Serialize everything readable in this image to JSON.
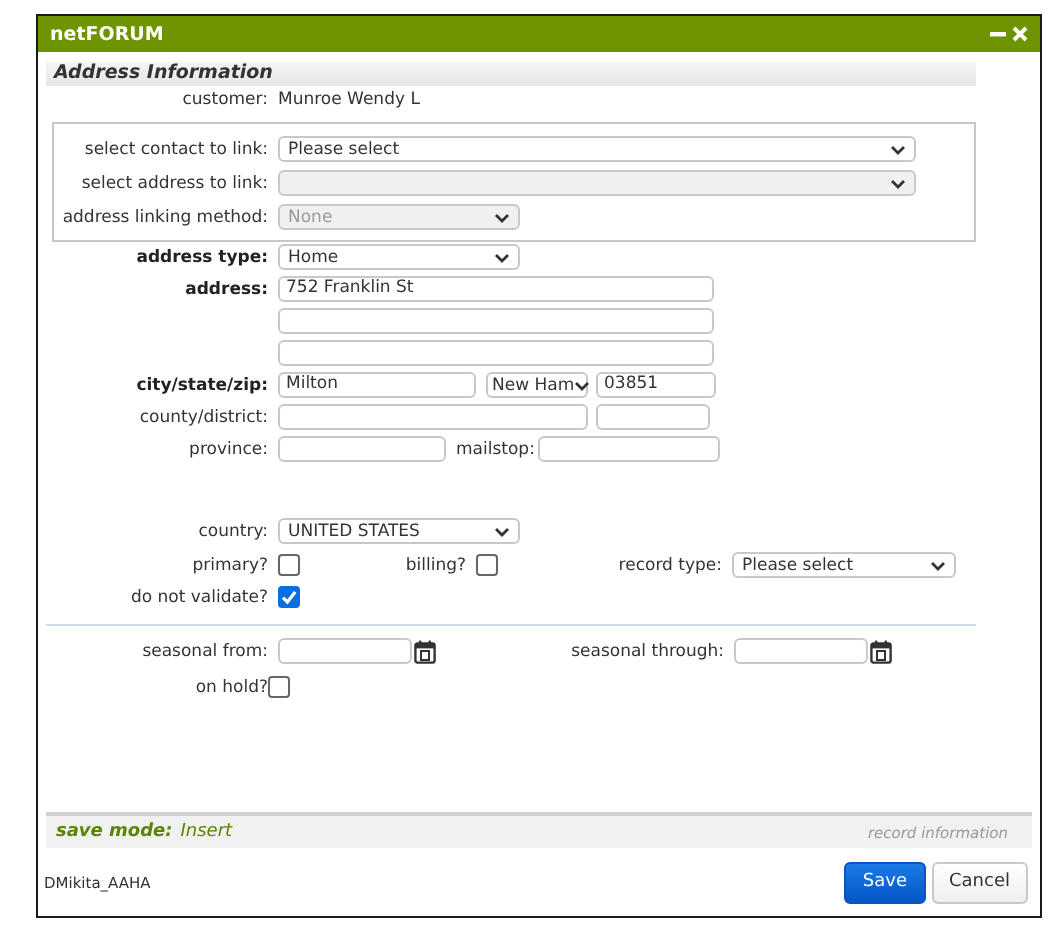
{
  "window": {
    "title": "netFORUM"
  },
  "section_title": "Address Information",
  "customer": {
    "label": "customer:",
    "value": "Munroe Wendy L"
  },
  "link_fields": [
    {
      "label": "select contact to link:",
      "value": "Please select",
      "disabled": false
    },
    {
      "label": "select address to link:",
      "disabled": true
    },
    {
      "label": "address linking method:",
      "value": "None",
      "disabled": true
    }
  ],
  "address_type": {
    "label": "address type:",
    "value": "Home",
    "required": true
  },
  "address": {
    "label": "address:",
    "required": true,
    "lines": [
      {
        "kind": "input",
        "value": "752 Franklin St"
      },
      {
        "kind": "input"
      },
      {
        "kind": "input"
      }
    ]
  },
  "city_state_zip": {
    "label": "city/state/zip:",
    "required": true,
    "city": "Milton",
    "state": "New Ham",
    "zip": "03851"
  },
  "county_district": {
    "label": "county/district:"
  },
  "province": {
    "label": "province:"
  },
  "mailstop": {
    "label": "mailstop:"
  },
  "country": {
    "label": "country:",
    "value": "UNITED STATES"
  },
  "primary": {
    "label": "primary?",
    "checked": false
  },
  "billing": {
    "label": "billing?",
    "checked": false
  },
  "record_type": {
    "label": "record type:",
    "value": "Please select"
  },
  "do_not_validate": {
    "label": "do not validate?",
    "checked": true
  },
  "seasonal_from": {
    "label": "seasonal from:"
  },
  "seasonal_through": {
    "label": "seasonal through:"
  },
  "on_hold": {
    "label": "on hold?",
    "checked": false
  },
  "status_bar": {
    "label": "save mode:",
    "value": "Insert",
    "link": "record information"
  },
  "footer": {
    "user": "DMikita_AAHA",
    "buttons": [
      {
        "label": "Save",
        "kind": "primary"
      },
      {
        "label": "Cancel",
        "kind": "secondary"
      }
    ]
  }
}
